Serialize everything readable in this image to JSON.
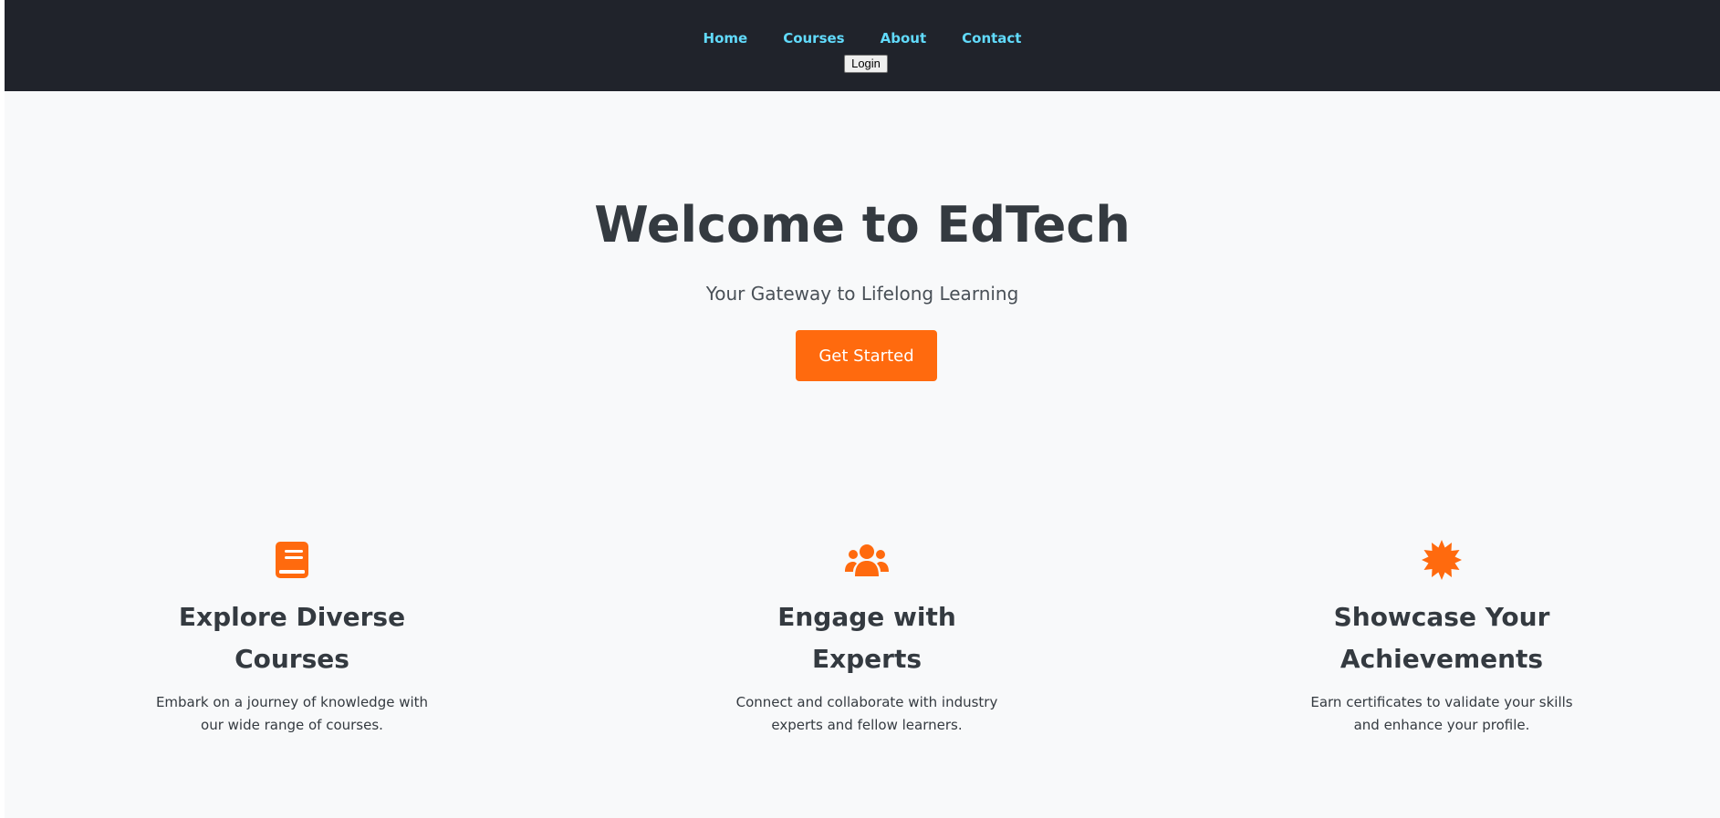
{
  "nav": {
    "items": [
      {
        "label": "Home"
      },
      {
        "label": "Courses"
      },
      {
        "label": "About"
      },
      {
        "label": "Contact"
      }
    ],
    "login_label": "Login"
  },
  "hero": {
    "title": "Welcome to EdTech",
    "subtitle": "Your Gateway to Lifelong Learning",
    "cta_label": "Get Started"
  },
  "features": [
    {
      "icon": "book-icon",
      "title": "Explore Diverse Courses",
      "description": "Embark on a journey of knowledge with our wide range of courses."
    },
    {
      "icon": "users-icon",
      "title": "Engage with Experts",
      "description": "Connect and collaborate with industry experts and fellow learners."
    },
    {
      "icon": "certificate-icon",
      "title": "Showcase Your Achievements",
      "description": "Earn certificates to validate your skills and enhance your profile."
    }
  ],
  "colors": {
    "topbar": "#20232b",
    "nav_link": "#61dafb",
    "accent": "#ff6a0e",
    "heading": "#343a40",
    "background": "#f8f9fa"
  }
}
